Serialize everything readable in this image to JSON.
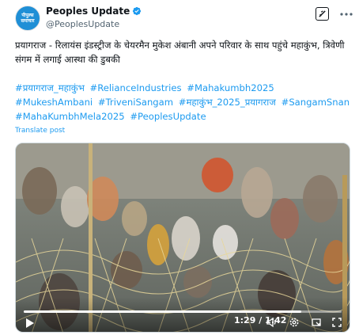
{
  "author": {
    "display_name": "Peoples Update",
    "handle": "@PeoplesUpdate",
    "avatar_text_line1": "पीपुल्स",
    "avatar_text_line2": "समाचार",
    "avatar_color": "#1f8fd6",
    "verified_color": "#1d9bf0"
  },
  "tweet": {
    "text": "प्रयागराज - रिलायंस इंडस्ट्रीज के चेयरमैन मुकेश अंबानी अपने परिवार के साथ पहुंचे महाकुंभ, त्रिवेणी संगम में लगाई आस्था की डुबकी",
    "hashtags": [
      "#प्रयागराज_महाकुंभ",
      "#RelianceIndustries",
      "#Mahakumbh2025",
      "#MukeshAmbani",
      "#TriveniSangam",
      "#महाकुंभ_2025_प्रयागराज",
      "#SangamSnan",
      "#MahaKumbhMela2025",
      "#PeoplesUpdate"
    ],
    "translate_label": "Translate post"
  },
  "video": {
    "current_time": "1:29",
    "duration": "1:42",
    "time_display": "1:29 / 1:42",
    "progress_fraction": 0.873
  },
  "icons": {
    "grok": "grok-icon",
    "more": "more-icon",
    "play": "play-icon",
    "volume": "volume-icon",
    "settings": "settings-icon",
    "pip": "picture-in-picture-icon",
    "fullscreen": "fullscreen-icon"
  },
  "colors": {
    "link": "#1d9bf0",
    "text": "#0f1419",
    "secondary": "#536471"
  }
}
